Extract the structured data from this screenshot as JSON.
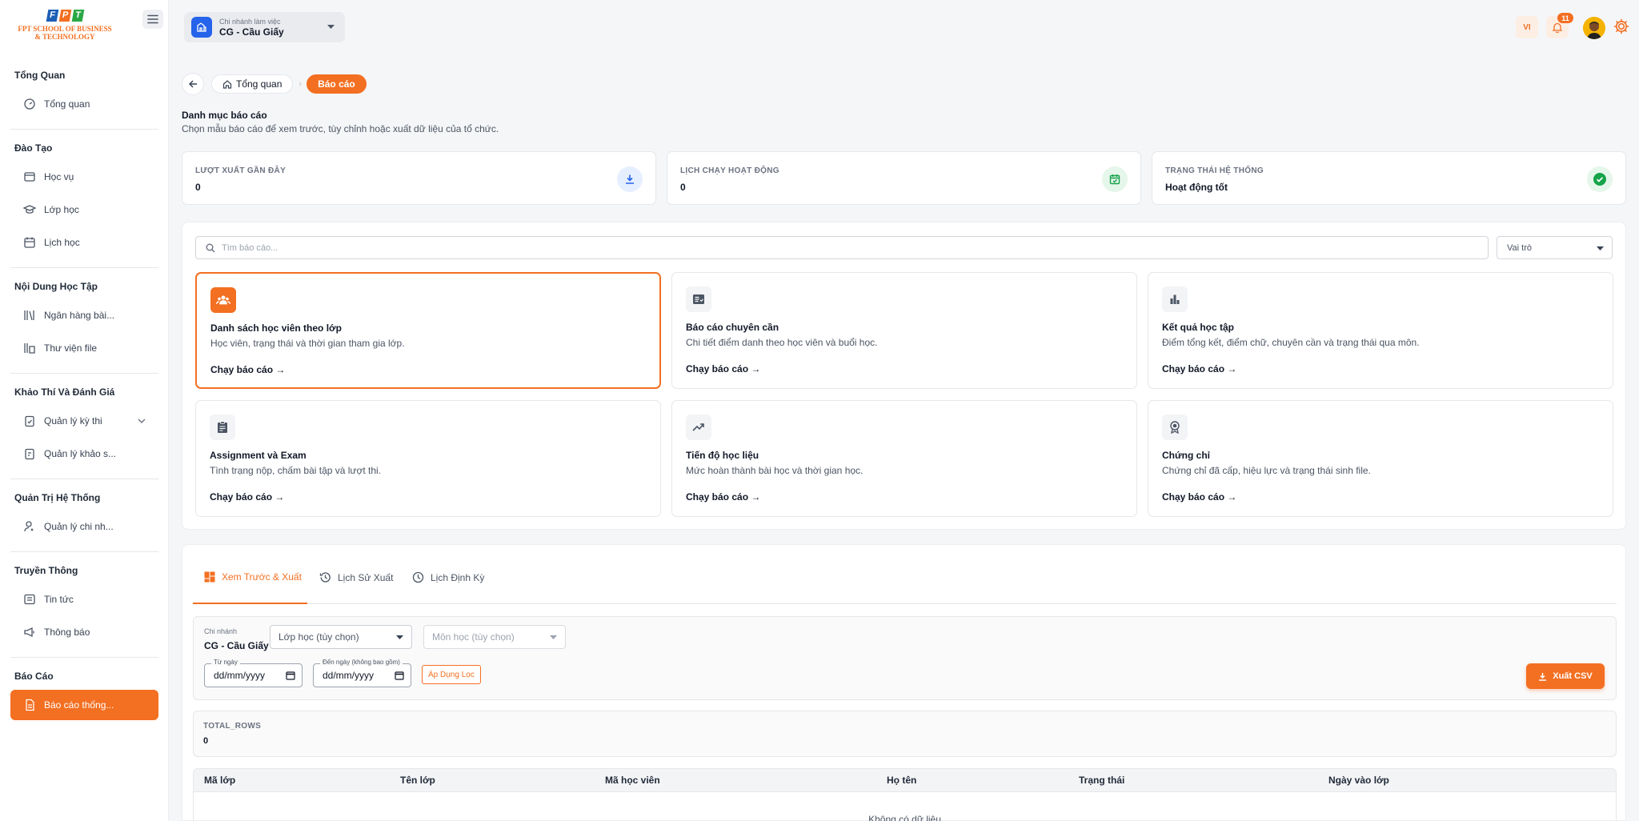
{
  "brand": {
    "logo_letters": [
      "F",
      "P",
      "T"
    ],
    "logo_line1": "FPT SCHOOL OF BUSINESS",
    "logo_line2": "& TECHNOLOGY",
    "accent_color": "#f36f21",
    "logo_colors": [
      "#1c5fb5",
      "#f36f21",
      "#2aa745"
    ]
  },
  "sidebar": {
    "sections": [
      {
        "title": "Tổng Quan",
        "items": [
          {
            "label": "Tổng quan",
            "icon": "dashboard-icon"
          }
        ]
      },
      {
        "title": "Đào Tạo",
        "items": [
          {
            "label": "Học vụ",
            "icon": "academic-icon"
          },
          {
            "label": "Lớp học",
            "icon": "class-icon"
          },
          {
            "label": "Lịch học",
            "icon": "calendar-icon"
          }
        ]
      },
      {
        "title": "Nội Dung Học Tập",
        "items": [
          {
            "label": "Ngân hàng bài...",
            "icon": "library-icon"
          },
          {
            "label": "Thư viện file",
            "icon": "files-icon"
          }
        ]
      },
      {
        "title": "Khảo Thí Và Đánh Giá",
        "items": [
          {
            "label": "Quản lý kỳ thi",
            "icon": "exam-icon"
          },
          {
            "label": "Quản lý khảo s...",
            "icon": "survey-icon"
          }
        ]
      },
      {
        "title": "Quản Trị Hệ Thống",
        "items": [
          {
            "label": "Quản lý chi nh...",
            "icon": "user-admin-icon"
          }
        ]
      },
      {
        "title": "Truyền Thông",
        "items": [
          {
            "label": "Tin tức",
            "icon": "news-icon"
          },
          {
            "label": "Thông báo",
            "icon": "megaphone-icon"
          }
        ]
      },
      {
        "title": "Báo Cáo",
        "items": [
          {
            "label": "Báo cáo thống...",
            "icon": "report-icon"
          }
        ]
      }
    ]
  },
  "header": {
    "branch_label": "Chi nhánh làm việc",
    "branch_value": "CG - Cầu Giấy",
    "language": "VI",
    "notification_count": "11"
  },
  "breadcrumb": {
    "home": "Tổng quan",
    "current": "Báo cáo"
  },
  "page": {
    "title": "Danh mục báo cáo",
    "subtitle": "Chọn mẫu báo cáo để xem trước, tùy chỉnh hoặc xuất dữ liệu của tổ chức."
  },
  "stats": [
    {
      "label": "LƯỢT XUẤT GẦN ĐÂY",
      "value": "0",
      "icon": "download-icon",
      "color": "#2563eb"
    },
    {
      "label": "LỊCH CHẠY HOẠT ĐỘNG",
      "value": "0",
      "icon": "calendar-check-icon",
      "color": "#16a34a"
    },
    {
      "label": "TRẠNG THÁI HỆ THỐNG",
      "value": "Hoạt động tốt",
      "icon": "check-circle-icon",
      "color": "#16a34a"
    }
  ],
  "catalog": {
    "search_placeholder": "Tìm báo cáo...",
    "role_select": "Vai trò",
    "run_label": "Chạy báo cáo →",
    "cards": [
      {
        "title": "Danh sách học viên theo lớp",
        "desc": "Học viên, trạng thái và thời gian tham gia lớp.",
        "icon": "group-icon"
      },
      {
        "title": "Báo cáo chuyên cần",
        "desc": "Chi tiết điểm danh theo học viên và buổi học.",
        "icon": "attendance-icon"
      },
      {
        "title": "Kết quả học tập",
        "desc": "Điểm tổng kết, điểm chữ, chuyên cần và trạng thái qua môn.",
        "icon": "bar-chart-icon"
      },
      {
        "title": "Assignment và Exam",
        "desc": "Tình trạng nộp, chấm bài tập và lượt thi.",
        "icon": "assignment-icon"
      },
      {
        "title": "Tiến độ học liệu",
        "desc": "Mức hoàn thành bài học và thời gian học.",
        "icon": "trending-up-icon"
      },
      {
        "title": "Chứng chỉ",
        "desc": "Chứng chỉ đã cấp, hiệu lực và trạng thái sinh file.",
        "icon": "certificate-icon"
      }
    ]
  },
  "tabs": [
    {
      "label": "Xem Trước & Xuất",
      "icon": "dashboard-grid-icon"
    },
    {
      "label": "Lịch Sử Xuất",
      "icon": "history-icon"
    },
    {
      "label": "Lịch Định Kỳ",
      "icon": "clock-icon"
    }
  ],
  "filters": {
    "branch_label": "Chi nhánh",
    "branch_value": "CG - Cầu Giấy",
    "class_placeholder": "Lớp học (tùy chọn)",
    "subject_placeholder": "Môn học (tùy chọn)",
    "from_label": "Từ ngày",
    "from_value": "dd/mm/yyyy",
    "to_label": "Đến ngày (không bao gồm)",
    "to_value": "dd/mm/yyyy",
    "apply_label": "Áp Dụng Lọc",
    "export_label": "Xuất CSV"
  },
  "summary": {
    "label": "TOTAL_ROWS",
    "value": "0"
  },
  "table": {
    "columns": [
      "Mã lớp",
      "Tên lớp",
      "Mã học viên",
      "Họ tên",
      "Trạng thái",
      "Ngày vào lớp"
    ],
    "empty_text": "Không có dữ liệu"
  }
}
